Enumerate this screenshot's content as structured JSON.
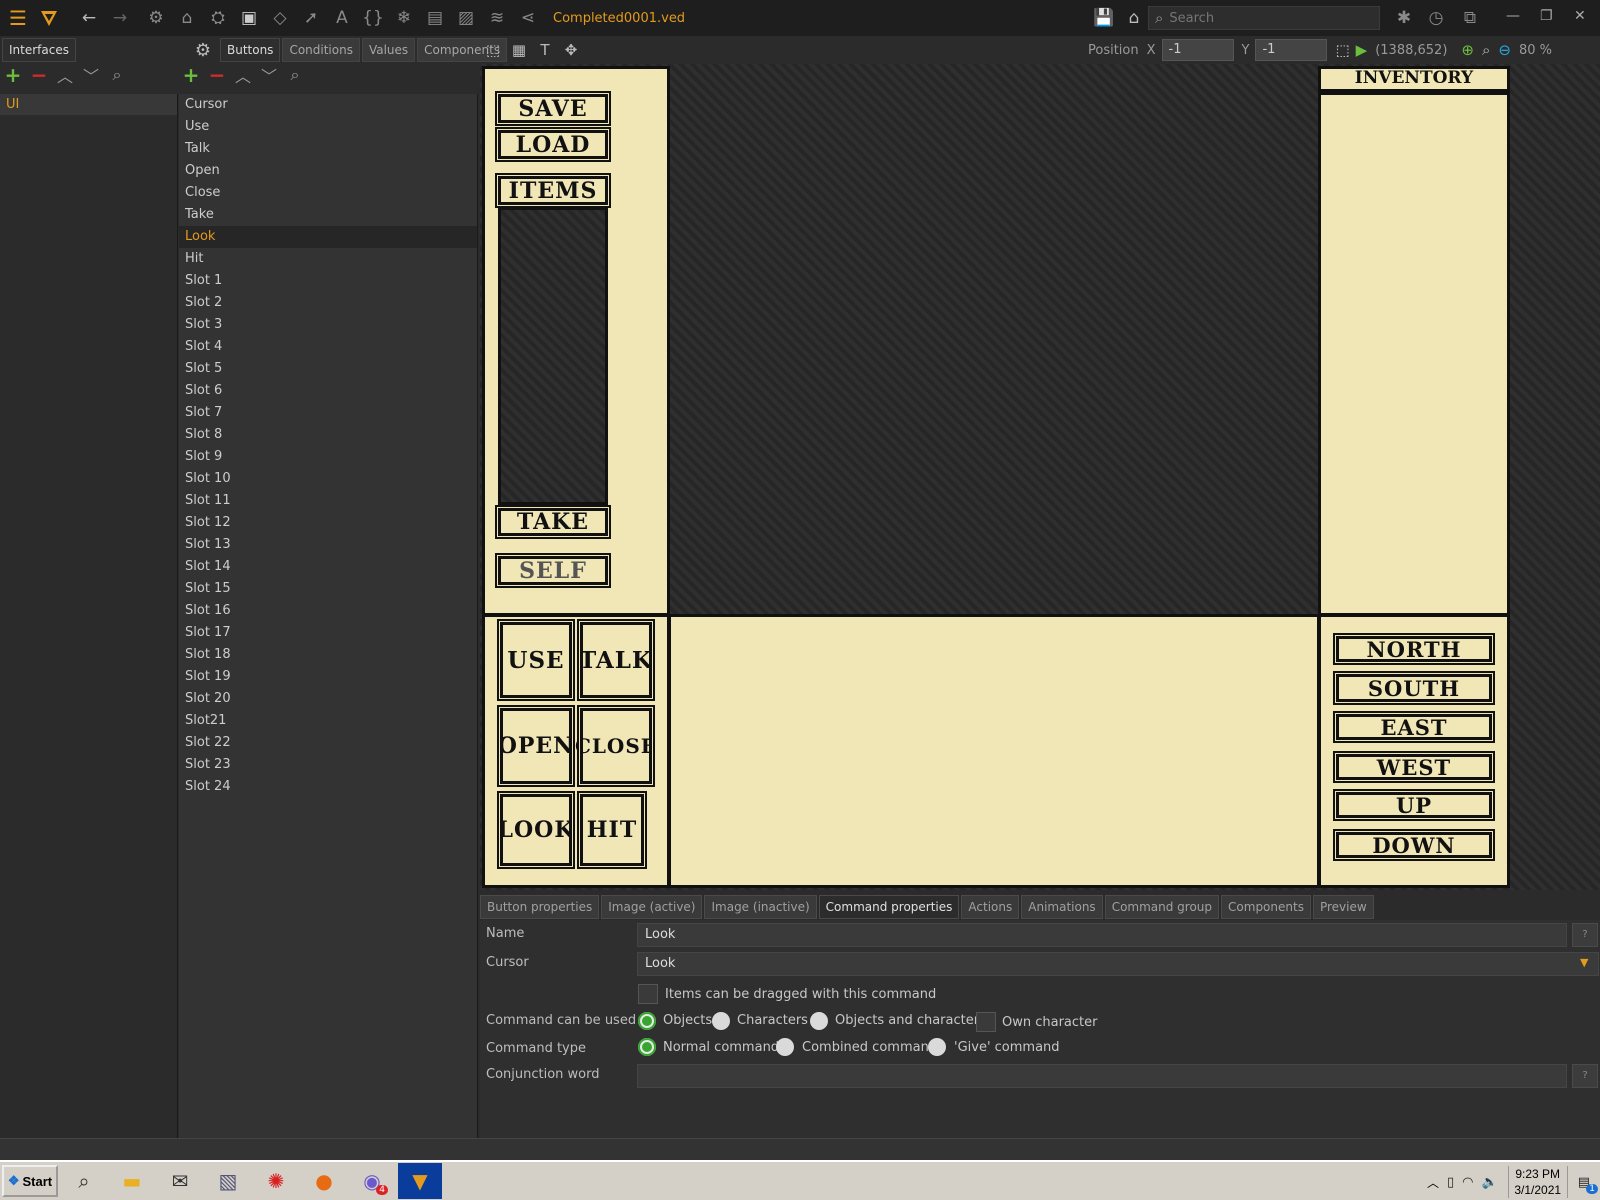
{
  "app": {
    "filename": "Completed0001.ved",
    "search_placeholder": "Search"
  },
  "left": {
    "tabs": [
      "Interfaces",
      "Buttons",
      "Conditions",
      "Values",
      "Components"
    ],
    "interfaces": [
      "UI"
    ],
    "buttons": [
      "Cursor",
      "Use",
      "Talk",
      "Open",
      "Close",
      "Take",
      "Look",
      "Hit",
      "Slot 1",
      "Slot 2",
      "Slot 3",
      "Slot 4",
      "Slot 5",
      "Slot 6",
      "Slot 7",
      "Slot 8",
      "Slot 9",
      "Slot 10",
      "Slot 11",
      "Slot 12",
      "Slot 13",
      "Slot 14",
      "Slot 15",
      "Slot 16",
      "Slot 17",
      "Slot 18",
      "Slot 19",
      "Slot 20",
      "Slot21",
      "Slot 22",
      "Slot 23",
      "Slot 24"
    ],
    "selected_button": "Look"
  },
  "canvas": {
    "position_label": "Position",
    "x_label": "X",
    "x_value": "-1",
    "y_label": "Y",
    "y_value": "-1",
    "cursor_coords": "(1388,652)",
    "zoom": "80 %"
  },
  "game_ui": {
    "save": "SAVE",
    "load": "LOAD",
    "items": "ITEMS",
    "take": "TAKE",
    "self": "SELF",
    "inventory": "INVENTORY",
    "use": "USE",
    "talk": "TALK",
    "open": "OPEN",
    "close": "CLOSE",
    "look": "LOOK",
    "hit": "HIT",
    "north": "NORTH",
    "south": "SOUTH",
    "east": "EAST",
    "west": "WEST",
    "up": "UP",
    "down": "DOWN"
  },
  "props": {
    "tabs": [
      "Button properties",
      "Image (active)",
      "Image (inactive)",
      "Command properties",
      "Actions",
      "Animations",
      "Command group",
      "Components",
      "Preview"
    ],
    "active_tab": "Command properties",
    "name_label": "Name",
    "name_value": "Look",
    "cursor_label": "Cursor",
    "cursor_value": "Look",
    "drag_label": "Items can be dragged with this command",
    "used_on_label": "Command can be used on",
    "used_on_options": [
      "Objects",
      "Characters",
      "Objects and characters"
    ],
    "own_character": "Own character",
    "type_label": "Command type",
    "type_options": [
      "Normal command",
      "Combined command",
      "'Give' command"
    ],
    "conjunction_label": "Conjunction word",
    "conjunction_value": ""
  },
  "taskbar": {
    "start": "Start",
    "time": "9:23 PM",
    "date": "3/1/2021",
    "notification_count": "1",
    "badge_count": "4"
  },
  "colors": {
    "accent": "#e39b1d",
    "parchment": "#f1e6b6",
    "radio_on": "#37a630"
  }
}
